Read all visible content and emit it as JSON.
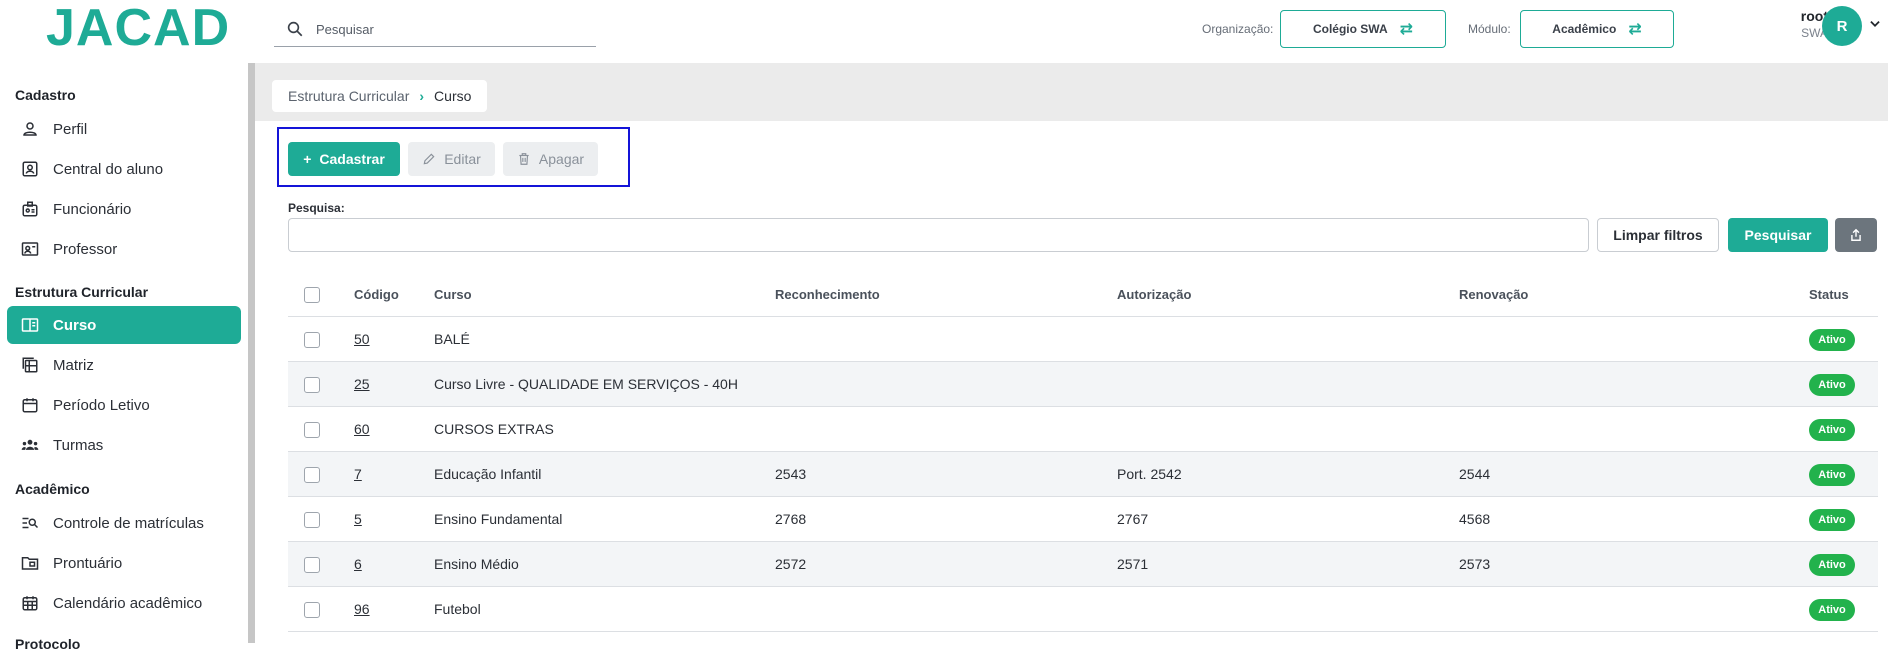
{
  "header": {
    "logo": "JACAD",
    "search_placeholder": "Pesquisar",
    "org_label": "Organização:",
    "org_value": "Colégio SWA",
    "module_label": "Módulo:",
    "module_value": "Acadêmico",
    "user_name": "root",
    "user_org": "SWA",
    "avatar_initial": "R"
  },
  "sidebar": {
    "sections": [
      {
        "title": "Cadastro",
        "items": [
          {
            "label": "Perfil",
            "icon": "person-icon"
          },
          {
            "label": "Central do aluno",
            "icon": "student-card-icon"
          },
          {
            "label": "Funcionário",
            "icon": "badge-icon"
          },
          {
            "label": "Professor",
            "icon": "teacher-icon"
          }
        ]
      },
      {
        "title": "Estrutura Curricular",
        "items": [
          {
            "label": "Curso",
            "icon": "book-icon",
            "active": true
          },
          {
            "label": "Matriz",
            "icon": "grid-icon"
          },
          {
            "label": "Período Letivo",
            "icon": "calendar-icon"
          },
          {
            "label": "Turmas",
            "icon": "group-icon"
          }
        ]
      },
      {
        "title": "Acadêmico",
        "items": [
          {
            "label": "Controle de matrículas",
            "icon": "list-search-icon"
          },
          {
            "label": "Prontuário",
            "icon": "folder-icon"
          },
          {
            "label": "Calendário acadêmico",
            "icon": "calendar-grid-icon"
          }
        ]
      },
      {
        "title": "Protocolo",
        "items": []
      }
    ]
  },
  "breadcrumb": {
    "parent": "Estrutura Curricular",
    "current": "Curso"
  },
  "actions": {
    "create": "Cadastrar",
    "edit": "Editar",
    "delete": "Apagar"
  },
  "filter": {
    "label": "Pesquisa:",
    "value": "",
    "clear_label": "Limpar filtros",
    "search_label": "Pesquisar"
  },
  "table": {
    "columns": [
      "Código",
      "Curso",
      "Reconhecimento",
      "Autorização",
      "Renovação",
      "Status"
    ],
    "rows": [
      {
        "code": "50",
        "course": "BALÉ",
        "recognition": "",
        "authorization": "",
        "renewal": "",
        "status": "Ativo"
      },
      {
        "code": "25",
        "course": "Curso Livre - QUALIDADE EM SERVIÇOS - 40H",
        "recognition": "",
        "authorization": "",
        "renewal": "",
        "status": "Ativo"
      },
      {
        "code": "60",
        "course": "CURSOS EXTRAS",
        "recognition": "",
        "authorization": "",
        "renewal": "",
        "status": "Ativo"
      },
      {
        "code": "7",
        "course": "Educação Infantil",
        "recognition": "2543",
        "authorization": "Port. 2542",
        "renewal": "2544",
        "status": "Ativo"
      },
      {
        "code": "5",
        "course": "Ensino Fundamental",
        "recognition": "2768",
        "authorization": "2767",
        "renewal": "4568",
        "status": "Ativo"
      },
      {
        "code": "6",
        "course": "Ensino Médio",
        "recognition": "2572",
        "authorization": "2571",
        "renewal": "2573",
        "status": "Ativo"
      },
      {
        "code": "96",
        "course": "Futebol",
        "recognition": "",
        "authorization": "",
        "renewal": "",
        "status": "Ativo"
      }
    ]
  },
  "colors": {
    "accent": "#1eab96",
    "status_active": "#22b24c",
    "highlight_box": "#1414d8"
  }
}
